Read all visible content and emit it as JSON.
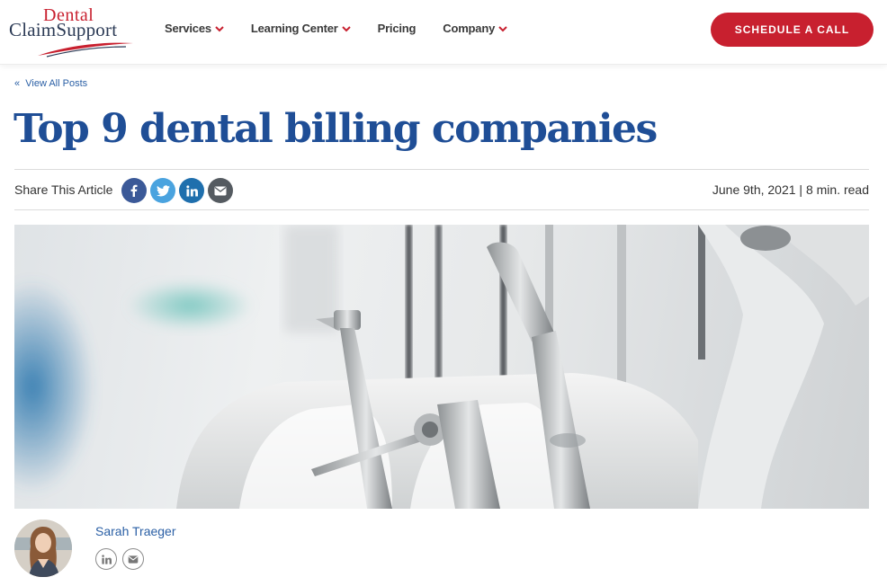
{
  "brand": {
    "logo_top": "Dental",
    "logo_main": "ClaimSupport",
    "accent_red": "#c8202f",
    "accent_blue": "#1f4e96"
  },
  "nav": {
    "items": [
      {
        "label": "Services",
        "has_dropdown": true
      },
      {
        "label": "Learning Center",
        "has_dropdown": true
      },
      {
        "label": "Pricing",
        "has_dropdown": false
      },
      {
        "label": "Company",
        "has_dropdown": true
      }
    ],
    "cta": "SCHEDULE A CALL"
  },
  "article": {
    "back_link": "View All Posts",
    "title": "Top 9 dental billing companies",
    "share_label": "Share This Article",
    "share_icons": [
      "facebook-icon",
      "twitter-icon",
      "linkedin-icon",
      "email-icon"
    ],
    "date": "June 9th, 2021",
    "read_time": "8 min. read"
  },
  "author": {
    "name": "Sarah Traeger",
    "icons": [
      "linkedin-icon",
      "email-icon"
    ]
  }
}
